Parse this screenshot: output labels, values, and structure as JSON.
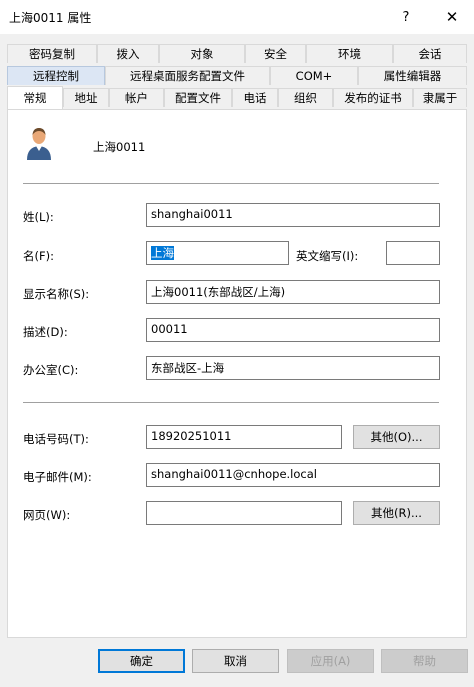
{
  "window": {
    "title": "上海0011 属性",
    "help_label": "?",
    "close_label": "✕"
  },
  "tabs": {
    "row1": [
      "密码复制",
      "拨入",
      "对象",
      "安全",
      "环境",
      "会话"
    ],
    "row2": [
      "远程控制",
      "远程桌面服务配置文件",
      "COM+",
      "属性编辑器"
    ],
    "row3": [
      "常规",
      "地址",
      "帐户",
      "配置文件",
      "电话",
      "组织",
      "发布的证书",
      "隶属于"
    ]
  },
  "general": {
    "display_name_header": "上海0011",
    "surname_label": "姓(L):",
    "surname_value": "shanghai0011",
    "given_name_label": "名(F):",
    "given_name_value": "上海",
    "initials_label": "英文缩写(I):",
    "initials_value": "",
    "display_name_label": "显示名称(S):",
    "display_name_value": "上海0011(东部战区/上海)",
    "description_label": "描述(D):",
    "description_value": "00011",
    "office_label": "办公室(C):",
    "office_value": "东部战区-上海",
    "phone_label": "电话号码(T):",
    "phone_value": "18920251011",
    "phone_other_label": "其他(O)...",
    "email_label": "电子邮件(M):",
    "email_value": "shanghai0011@cnhope.local",
    "web_label": "网页(W):",
    "web_value": "",
    "web_other_label": "其他(R)..."
  },
  "footer": {
    "ok": "确定",
    "cancel": "取消",
    "apply": "应用(A)",
    "help": "帮助"
  }
}
